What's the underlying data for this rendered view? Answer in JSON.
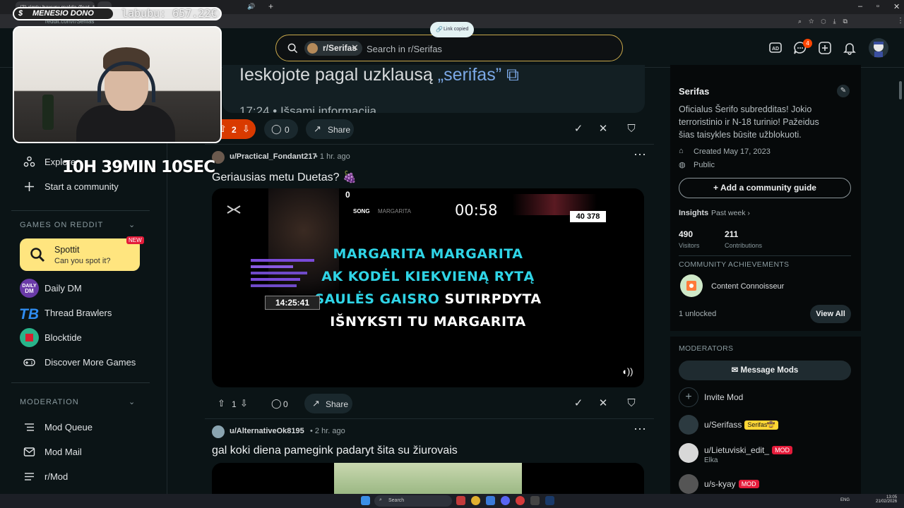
{
  "browser": {
    "tab_title": "(3) rimtu baxuru malda (feat. tv...",
    "url": "reddit.com/r/Serifas"
  },
  "header": {
    "community_chip": "r/Serifas",
    "search_placeholder": "Search in r/Serifas",
    "toast": "Link copied",
    "notification_count": "4"
  },
  "left_nav": {
    "explore": "Explore",
    "start_community": "Start a community",
    "games_heading": "GAMES ON REDDIT",
    "spottit_title": "Spottit",
    "spottit_sub": "Can you spot it?",
    "spottit_badge": "NEW",
    "games": [
      "Daily DM",
      "Thread Brawlers",
      "Blocktide",
      "Discover More Games"
    ],
    "moderation_heading": "MODERATION",
    "mod_items": [
      "Mod Queue",
      "Mod Mail",
      "r/Mod"
    ]
  },
  "top_card": {
    "search_text": "Ieskojote pagal uzklausą",
    "search_query": "„serifas”",
    "time_info": "17:24 • Išsami informacija"
  },
  "post0_actions": {
    "votes": "2",
    "comments": "0",
    "share": "Share"
  },
  "post1": {
    "author": "u/Practical_Fondant217",
    "age": "• 1 hr. ago",
    "title": "Geriausias metu Duetas? 🍇",
    "video": {
      "lyric1": "MARGARITA MARGARITA",
      "lyric2": "AK KODĖL KIEKVIENĄ RYTĄ",
      "lyric3a": "SAULĖS GAISRO",
      "lyric3b": "SUTIRPDYTA",
      "lyric4": "IŠNYKSTI TU MARGARITA",
      "time": "00:58",
      "count": "40 378",
      "song_label": "SONG",
      "song_name": "MARGARITA",
      "clock": "14:25:41",
      "zero": "0"
    },
    "votes": "1",
    "comments": "0",
    "share": "Share"
  },
  "post2": {
    "author": "u/AlternativeOk8195",
    "age": "• 2 hr. ago",
    "title": "gal koki diena pamegink padaryt šita su žiurovais"
  },
  "sidebar": {
    "name": "Serifas",
    "description": "Oficialus Šerifo subredditas! Jokio terroristinio ir N-18 turinio! Pažeidus šias taisykles būsite užblokuoti.",
    "created": "Created May 17, 2023",
    "visibility": "Public",
    "guide_button": "Add a community guide",
    "insights_label": "Insights",
    "insights_period": "Past week ›",
    "visitors_value": "490",
    "visitors_label": "Visitors",
    "contributions_value": "211",
    "contributions_label": "Contributions",
    "achievements_heading": "COMMUNITY ACHIEVEMENTS",
    "achievement_name": "Content Connoisseur",
    "unlocked": "1 unlocked",
    "view_all": "View All",
    "moderators_heading": "MODERATORS",
    "message_mods": "Message Mods",
    "invite_mod": "Invite Mod",
    "mods": [
      {
        "name": "u/Serifass",
        "flair": "Serifas🤠",
        "sub": ""
      },
      {
        "name": "u/Lietuviski_edit_",
        "flair": "MOD",
        "sub": "Elka"
      },
      {
        "name": "u/s-kyay",
        "flair": "MOD",
        "sub": ""
      }
    ]
  },
  "stream_overlay": {
    "dono_label": "MENESIO DONO",
    "dono_amount": "labubu: 657.22€",
    "timer": "10H 39MIN 10SEC"
  },
  "taskbar": {
    "search": "Search",
    "lang": "ENG",
    "time": "13:05",
    "date": "21/02/2026"
  },
  "colors": {
    "accent_orange": "#ff4500",
    "search_border": "#c8a84b",
    "lyric_cyan": "#2fd4e6",
    "mod_flair": "#e41b3a",
    "owner_flair": "#ffd635"
  }
}
